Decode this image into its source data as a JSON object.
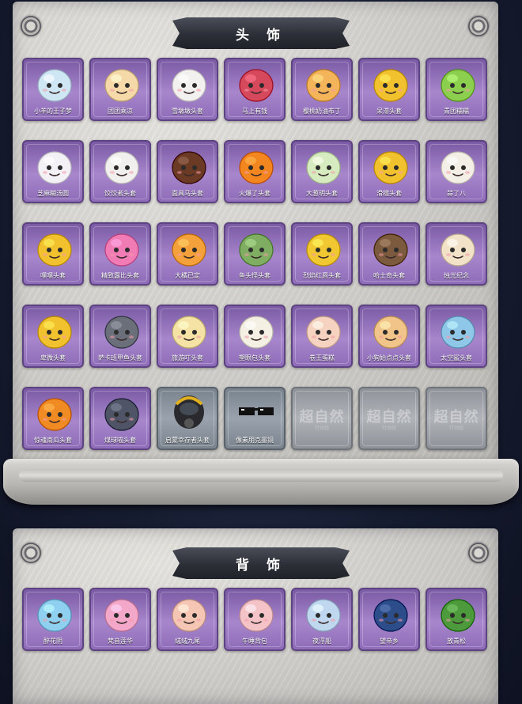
{
  "sections": {
    "headwear_title": "头 饰",
    "back_title": "背 饰"
  },
  "headwear": [
    {
      "name": "小羊的王子梦",
      "icon": "sheep-crown-icon",
      "color": "#cfe6f5",
      "type": "item"
    },
    {
      "name": "团团乘凉",
      "icon": "hamster-icon",
      "color": "#f6d9a8",
      "type": "item"
    },
    {
      "name": "雪墩墩头套",
      "icon": "snowman-hat-icon",
      "color": "#f3f1ef",
      "type": "item"
    },
    {
      "name": "马上有钱",
      "icon": "horse-red-icon",
      "color": "#d6485c",
      "type": "item"
    },
    {
      "name": "樱桃奶油布丁",
      "icon": "pudding-icon",
      "color": "#f4b45a",
      "type": "item"
    },
    {
      "name": "呆滞头套",
      "icon": "blank-face-icon",
      "color": "#f2c12e",
      "type": "item"
    },
    {
      "name": "青团糯糯",
      "icon": "green-dumpling-icon",
      "color": "#8ccf4f",
      "type": "item"
    },
    {
      "name": "芝麻糊汤圆",
      "icon": "rice-ball-icon",
      "color": "#f4f1f6",
      "type": "item"
    },
    {
      "name": "饺饺者头套",
      "icon": "dumpling-icon",
      "color": "#f1f0ee",
      "type": "item"
    },
    {
      "name": "面具马头套",
      "icon": "horse-mask-icon",
      "color": "#6b3a24",
      "type": "item"
    },
    {
      "name": "火爆了头套",
      "icon": "fire-face-icon",
      "color": "#f4861f",
      "type": "item"
    },
    {
      "name": "大葱明头套",
      "icon": "scallion-icon",
      "color": "#d6ebc0",
      "type": "item"
    },
    {
      "name": "滑稽头套",
      "icon": "smirk-face-icon",
      "color": "#f2c12e",
      "type": "item"
    },
    {
      "name": "蒜了八",
      "icon": "garlic-icon",
      "color": "#f3eee6",
      "type": "item"
    },
    {
      "name": "嘿嘿头套",
      "icon": "grin-face-icon",
      "color": "#f2c12e",
      "type": "item"
    },
    {
      "name": "精致露比头套",
      "icon": "pink-glasses-icon",
      "color": "#f07bb5",
      "type": "item"
    },
    {
      "name": "大橘已定",
      "icon": "orange-slice-icon",
      "color": "#f5a13b",
      "type": "item"
    },
    {
      "name": "鱼头怪头套",
      "icon": "fish-head-icon",
      "color": "#7fae63",
      "type": "item"
    },
    {
      "name": "烈焰红唇头套",
      "icon": "pikachu-shades-icon",
      "color": "#f1c832",
      "type": "item"
    },
    {
      "name": "哈士奇头套",
      "icon": "husky-shades-icon",
      "color": "#7b5a3e",
      "type": "item"
    },
    {
      "name": "烛光纪念",
      "icon": "candle-icon",
      "color": "#f2e2c8",
      "type": "item"
    },
    {
      "name": "卑微头套",
      "icon": "sad-face-icon",
      "color": "#f2c12e",
      "type": "item"
    },
    {
      "name": "萨卡班甲鱼头套",
      "icon": "fish-grey-icon",
      "color": "#6b6f7a",
      "type": "item"
    },
    {
      "name": "旅游叮头套",
      "icon": "duck-hat-icon",
      "color": "#f4e3a4",
      "type": "item"
    },
    {
      "name": "塑眼包头套",
      "icon": "bun-crown-icon",
      "color": "#f4f0e4",
      "type": "item"
    },
    {
      "name": "卷王蛋糕",
      "icon": "roll-cake-icon",
      "color": "#f6d3c0",
      "type": "item"
    },
    {
      "name": "小狗始点点头套",
      "icon": "dog-face-icon",
      "color": "#f1c48a",
      "type": "item"
    },
    {
      "name": "太空鲨头套",
      "icon": "shark-icon",
      "color": "#8fc7e8",
      "type": "item"
    },
    {
      "name": "惊魂南瓜头套",
      "icon": "pumpkin-icon",
      "color": "#f08a23",
      "type": "item"
    },
    {
      "name": "煤球喵头套",
      "icon": "cat-icon",
      "color": "#4f5566",
      "type": "item"
    },
    {
      "name": "启蒙幸存者头套",
      "icon": "gas-mask-icon",
      "color": "#2a2a2e",
      "type": "dark"
    },
    {
      "name": "像素朋克墨镜",
      "icon": "pixel-glasses-icon",
      "color": "#111111",
      "type": "dark"
    },
    {
      "name": "",
      "icon": "locked-slot-icon",
      "color": "#b0b3b8",
      "type": "empty"
    },
    {
      "name": "",
      "icon": "locked-slot-icon",
      "color": "#b0b3b8",
      "type": "empty"
    },
    {
      "name": "",
      "icon": "locked-slot-icon",
      "color": "#b0b3b8",
      "type": "empty"
    }
  ],
  "backwear": [
    {
      "name": "醉花阴",
      "icon": "flower-wings-icon",
      "color": "#8fd0f0",
      "type": "item"
    },
    {
      "name": "梵音莲华",
      "icon": "lotus-fairy-icon",
      "color": "#f3a7c9",
      "type": "item"
    },
    {
      "name": "绒绒九尾",
      "icon": "nine-tail-fox-icon",
      "color": "#f6c6b4",
      "type": "item"
    },
    {
      "name": "午睡背包",
      "icon": "pig-bag-icon",
      "color": "#f3c3c8",
      "type": "item"
    },
    {
      "name": "夜浮船",
      "icon": "ghost-ship-icon",
      "color": "#bfd7ef",
      "type": "item"
    },
    {
      "name": "望帝乡",
      "icon": "opera-figure-icon",
      "color": "#2d4d8a",
      "type": "item"
    },
    {
      "name": "放青松",
      "icon": "bonsai-pine-icon",
      "color": "#4c9a3c",
      "type": "item"
    }
  ],
  "watermark": {
    "text": "超自然",
    "sub": "行动组"
  }
}
